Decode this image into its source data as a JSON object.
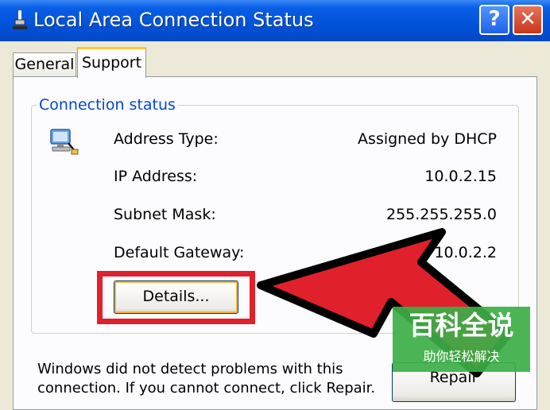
{
  "window": {
    "title": "Local Area Connection Status",
    "help_label": "?",
    "close_label": "✕"
  },
  "tabs": [
    {
      "label": "General",
      "selected": false
    },
    {
      "label": "Support",
      "selected": true
    }
  ],
  "connection_status": {
    "group_label": "Connection status",
    "fields": [
      {
        "label": "Address Type:",
        "value": "Assigned by DHCP"
      },
      {
        "label": "IP Address:",
        "value": "10.0.2.15"
      },
      {
        "label": "Subnet Mask:",
        "value": "255.255.255.0"
      },
      {
        "label": "Default Gateway:",
        "value": "10.0.2.2"
      }
    ],
    "details_label": "Details..."
  },
  "message": {
    "text": "Windows did not detect problems with this connection. If you cannot connect, click Repair."
  },
  "repair_label": "Repair",
  "watermark": {
    "main": "百科全说",
    "sub": "助你轻松解决"
  },
  "colors": {
    "titlebar": "#0052d9",
    "group_label": "#0046d5",
    "highlight": "#e0202a",
    "arrow": "#e0202a",
    "watermark": "#3caf46"
  },
  "icons": {
    "app": "network-plug-icon",
    "connection": "network-computer-icon"
  }
}
